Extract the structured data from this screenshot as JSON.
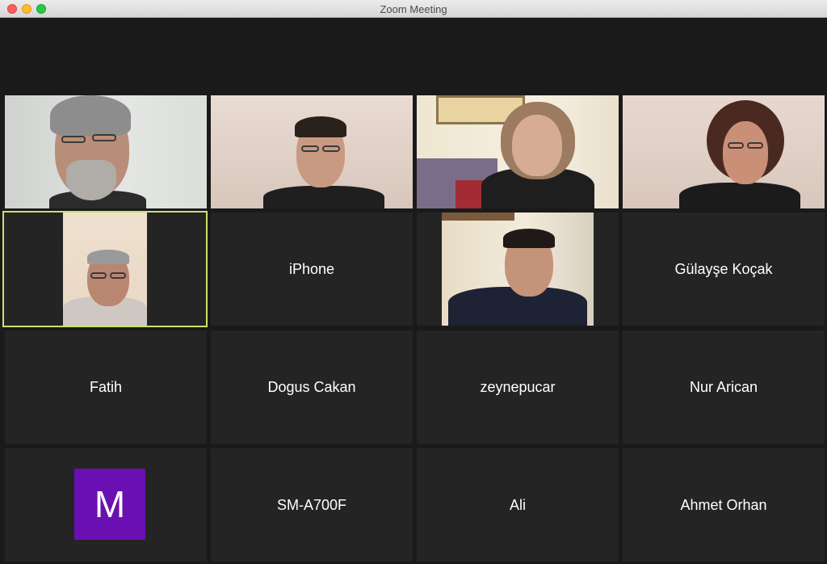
{
  "window": {
    "title": "Zoom Meeting"
  },
  "participants": [
    {
      "tile": "video-1"
    },
    {
      "tile": "video-2"
    },
    {
      "tile": "video-3"
    },
    {
      "tile": "video-4"
    },
    {
      "tile": "video-5-active"
    },
    {
      "name": "iPhone"
    },
    {
      "tile": "video-7"
    },
    {
      "name": "Gülayşe Koçak"
    },
    {
      "name": "Fatih"
    },
    {
      "name": "Dogus Cakan"
    },
    {
      "name": "zeynepucar"
    },
    {
      "name": "Nur Arican"
    },
    {
      "avatar_letter": "M",
      "avatar_color": "#6a0fb2"
    },
    {
      "name": "SM-A700F"
    },
    {
      "name": "Ali"
    },
    {
      "name": "Ahmet Orhan"
    }
  ],
  "colors": {
    "stage_background": "#1a1a1a",
    "tile_background": "#242424",
    "active_speaker_border": "#c8e26a",
    "avatar_purple": "#6a0fb2"
  }
}
